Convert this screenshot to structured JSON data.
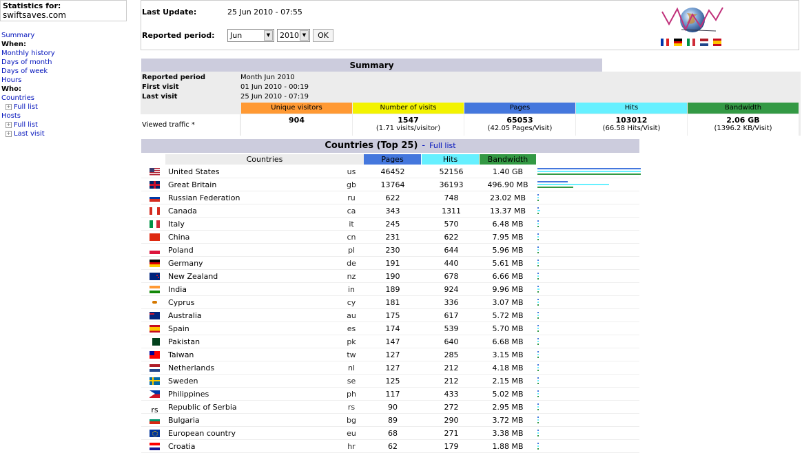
{
  "sidebar": {
    "stats_label": "Statistics for:",
    "site": "swiftsaves.com",
    "items": [
      {
        "label": "Summary",
        "type": "link"
      },
      {
        "label": "When:",
        "type": "heading"
      },
      {
        "label": "Monthly history",
        "type": "link"
      },
      {
        "label": "Days of month",
        "type": "link"
      },
      {
        "label": "Days of week",
        "type": "link"
      },
      {
        "label": "Hours",
        "type": "link"
      },
      {
        "label": "Who:",
        "type": "heading"
      },
      {
        "label": "Countries",
        "type": "link"
      },
      {
        "label": "Full list",
        "type": "sub"
      },
      {
        "label": "Hosts",
        "type": "link"
      },
      {
        "label": "Full list",
        "type": "sub"
      },
      {
        "label": "Last visit",
        "type": "sub"
      }
    ]
  },
  "header": {
    "last_update_label": "Last Update:",
    "last_update_value": "25 Jun 2010 - 07:55",
    "period_label": "Reported period:",
    "month": "Jun",
    "year": "2010",
    "ok_label": "OK"
  },
  "summary": {
    "title": "Summary",
    "reported_period_label": "Reported period",
    "reported_period_value": "Month Jun 2010",
    "first_visit_label": "First visit",
    "first_visit_value": "01 Jun 2010 - 00:19",
    "last_visit_label": "Last visit",
    "last_visit_value": "25 Jun 2010 - 07:19",
    "viewed_label": "Viewed traffic *",
    "columns": [
      {
        "label": "Unique visitors",
        "color": "#ff9933",
        "value": "904",
        "sub": ""
      },
      {
        "label": "Number of visits",
        "color": "#f3f300",
        "value": "1547",
        "sub": "(1.71 visits/visitor)"
      },
      {
        "label": "Pages",
        "color": "#4477dd",
        "value": "65053",
        "sub": "(42.05 Pages/Visit)"
      },
      {
        "label": "Hits",
        "color": "#66f0ff",
        "value": "103012",
        "sub": "(66.58 Hits/Visit)"
      },
      {
        "label": "Bandwidth",
        "color": "#339944",
        "value": "2.06 GB",
        "sub": "(1396.2 KB/Visit)"
      }
    ]
  },
  "countries": {
    "title": "Countries (Top 25)",
    "dash": "-",
    "full_list_label": "Full list",
    "headers": {
      "countries": "Countries",
      "pages": "Pages",
      "hits": "Hits",
      "bandwidth": "Bandwidth"
    },
    "colors": {
      "pages": "#4477dd",
      "hits": "#66f0ff",
      "bandwidth": "#339944"
    },
    "rows": [
      {
        "name": "United States",
        "code": "us",
        "pages": 46452,
        "hits": 52156,
        "bw": "1.40 GB",
        "bw_kb": 1468006,
        "flag": "us-flag-icon"
      },
      {
        "name": "Great Britain",
        "code": "gb",
        "pages": 13764,
        "hits": 36193,
        "bw": "496.90 MB",
        "bw_kb": 508826,
        "flag": "gb-flag-icon"
      },
      {
        "name": "Russian Federation",
        "code": "ru",
        "pages": 622,
        "hits": 748,
        "bw": "23.02 MB",
        "bw_kb": 23572,
        "flag": "ru-flag-icon"
      },
      {
        "name": "Canada",
        "code": "ca",
        "pages": 343,
        "hits": 1311,
        "bw": "13.37 MB",
        "bw_kb": 13691,
        "flag": "ca-flag-icon"
      },
      {
        "name": "Italy",
        "code": "it",
        "pages": 245,
        "hits": 570,
        "bw": "6.48 MB",
        "bw_kb": 6636,
        "flag": "it-flag-icon"
      },
      {
        "name": "China",
        "code": "cn",
        "pages": 231,
        "hits": 622,
        "bw": "7.95 MB",
        "bw_kb": 8141,
        "flag": "cn-flag-icon"
      },
      {
        "name": "Poland",
        "code": "pl",
        "pages": 230,
        "hits": 644,
        "bw": "5.96 MB",
        "bw_kb": 6103,
        "flag": "pl-flag-icon"
      },
      {
        "name": "Germany",
        "code": "de",
        "pages": 191,
        "hits": 440,
        "bw": "5.61 MB",
        "bw_kb": 5745,
        "flag": "de-flag-icon"
      },
      {
        "name": "New Zealand",
        "code": "nz",
        "pages": 190,
        "hits": 678,
        "bw": "6.66 MB",
        "bw_kb": 6820,
        "flag": "nz-flag-icon"
      },
      {
        "name": "India",
        "code": "in",
        "pages": 189,
        "hits": 924,
        "bw": "9.96 MB",
        "bw_kb": 10199,
        "flag": "in-flag-icon"
      },
      {
        "name": "Cyprus",
        "code": "cy",
        "pages": 181,
        "hits": 336,
        "bw": "3.07 MB",
        "bw_kb": 3144,
        "flag": "cy-flag-icon"
      },
      {
        "name": "Australia",
        "code": "au",
        "pages": 175,
        "hits": 617,
        "bw": "5.72 MB",
        "bw_kb": 5857,
        "flag": "au-flag-icon"
      },
      {
        "name": "Spain",
        "code": "es",
        "pages": 174,
        "hits": 539,
        "bw": "5.70 MB",
        "bw_kb": 5837,
        "flag": "es-flag-icon"
      },
      {
        "name": "Pakistan",
        "code": "pk",
        "pages": 147,
        "hits": 640,
        "bw": "6.68 MB",
        "bw_kb": 6840,
        "flag": "pk-flag-icon"
      },
      {
        "name": "Taiwan",
        "code": "tw",
        "pages": 127,
        "hits": 285,
        "bw": "3.15 MB",
        "bw_kb": 3226,
        "flag": "tw-flag-icon"
      },
      {
        "name": "Netherlands",
        "code": "nl",
        "pages": 127,
        "hits": 212,
        "bw": "4.18 MB",
        "bw_kb": 4280,
        "flag": "nl-flag-icon"
      },
      {
        "name": "Sweden",
        "code": "se",
        "pages": 125,
        "hits": 212,
        "bw": "2.15 MB",
        "bw_kb": 2202,
        "flag": "se-flag-icon"
      },
      {
        "name": "Philippines",
        "code": "ph",
        "pages": 117,
        "hits": 433,
        "bw": "5.02 MB",
        "bw_kb": 5140,
        "flag": "ph-flag-icon"
      },
      {
        "name": "Republic of Serbia",
        "code": "rs",
        "pages": 90,
        "hits": 272,
        "bw": "2.95 MB",
        "bw_kb": 3021,
        "flag": "rs-text",
        "flag_text": "rs"
      },
      {
        "name": "Bulgaria",
        "code": "bg",
        "pages": 89,
        "hits": 290,
        "bw": "3.72 MB",
        "bw_kb": 3809,
        "flag": "bg-flag-icon"
      },
      {
        "name": "European country",
        "code": "eu",
        "pages": 68,
        "hits": 271,
        "bw": "3.38 MB",
        "bw_kb": 3461,
        "flag": "eu-flag-icon"
      },
      {
        "name": "Croatia",
        "code": "hr",
        "pages": 62,
        "hits": 179,
        "bw": "1.88 MB",
        "bw_kb": 1925,
        "flag": "hr-flag-icon"
      }
    ]
  }
}
